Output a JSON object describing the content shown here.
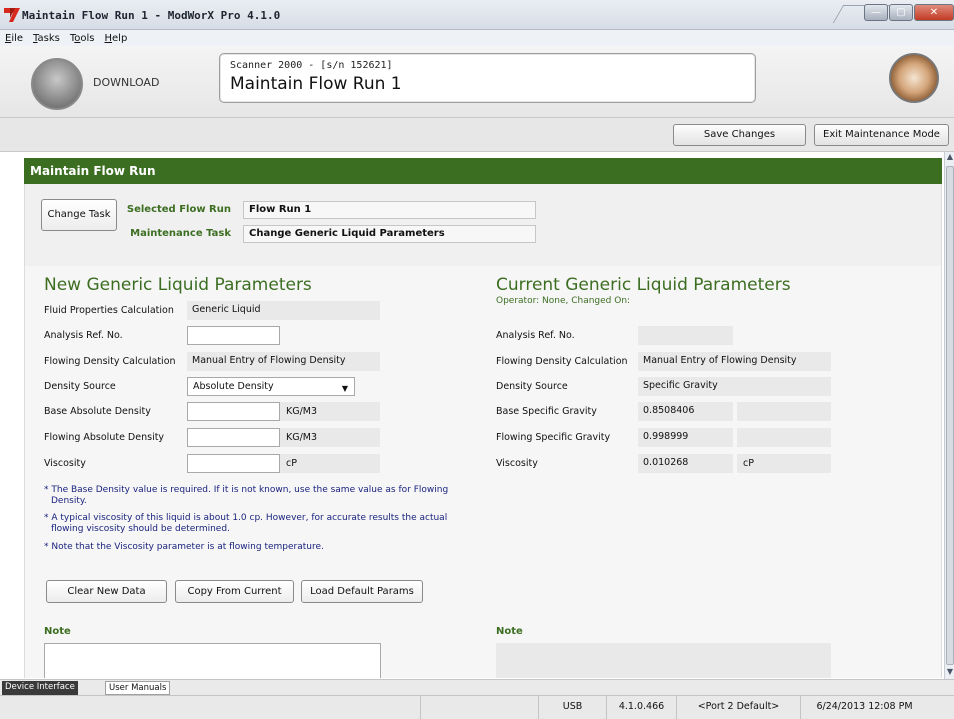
{
  "window": {
    "title": "Maintain Flow Run 1 - ModWorX Pro 4.1.0",
    "minimize": "—",
    "maximize": "▢",
    "close": "✕"
  },
  "menu": [
    {
      "key": "E",
      "rest": "ile"
    },
    {
      "key": "T",
      "rest": "asks"
    },
    {
      "key": "o",
      "pre": "T",
      "rest": "ols"
    },
    {
      "key": "H",
      "rest": "elp"
    }
  ],
  "header": {
    "download_label": "DOWNLOAD",
    "device_line": "Scanner 2000 -  [s/n 152621]",
    "screen_title": "Maintain Flow Run 1"
  },
  "toolbar": {
    "save_changes": "Save Changes",
    "exit_maintenance": "Exit Maintenance Mode"
  },
  "task": {
    "section_title": "Maintain Flow Run",
    "change_task_button": "Change Task",
    "selected_flow_run_label": "Selected Flow Run",
    "selected_flow_run_value": "Flow Run 1",
    "maintenance_task_label": "Maintenance Task",
    "maintenance_task_value": "Change Generic Liquid Parameters"
  },
  "new_params": {
    "title": "New Generic Liquid Parameters",
    "fluid_calc_label": "Fluid Properties Calculation",
    "fluid_calc_value": "Generic Liquid",
    "analysis_ref_label": "Analysis Ref. No.",
    "analysis_ref_value": "",
    "flowing_density_calc_label": "Flowing Density Calculation",
    "flowing_density_calc_value": "Manual Entry of Flowing Density",
    "density_source_label": "Density Source",
    "density_source_value": "Absolute Density",
    "base_abs_density_label": "Base Absolute Density",
    "base_abs_density_value": "",
    "base_abs_density_unit": "KG/M3",
    "flowing_abs_density_label": "Flowing Absolute Density",
    "flowing_abs_density_value": "",
    "flowing_abs_density_unit": "KG/M3",
    "viscosity_label": "Viscosity",
    "viscosity_value": "",
    "viscosity_unit": "cP",
    "note_1a": "* The Base Density value is required. If it is not known, use the same value as for Flowing",
    "note_1b": "Density.",
    "note_2a": "* A typical viscosity of this liquid is about 1.0 cp. However, for accurate results the actual",
    "note_2b": "flowing viscosity should be determined.",
    "note_3": "* Note that the Viscosity parameter is at flowing temperature.",
    "clear_button": "Clear New Data",
    "copy_button": "Copy From Current",
    "load_default_button": "Load Default Params",
    "note_label": "Note"
  },
  "current_params": {
    "title": "Current Generic Liquid Parameters",
    "operator_line": "Operator: None, Changed On:",
    "analysis_ref_label": "Analysis Ref. No.",
    "analysis_ref_value": "",
    "flowing_density_calc_label": "Flowing Density Calculation",
    "flowing_density_calc_value": "Manual Entry of Flowing Density",
    "density_source_label": "Density Source",
    "density_source_value": "Specific Gravity",
    "base_sg_label": "Base Specific Gravity",
    "base_sg_value": "0.8508406",
    "flowing_sg_label": "Flowing Specific Gravity",
    "flowing_sg_value": "0.998999",
    "viscosity_label": "Viscosity",
    "viscosity_value": "0.010268",
    "viscosity_unit": "cP",
    "note_label": "Note"
  },
  "tabs": {
    "device_interface": "Device Interface",
    "user_manuals": "User Manuals"
  },
  "status": {
    "connection": "USB",
    "version": "4.1.0.466",
    "port": "<Port 2 Default>",
    "datetime": "6/24/2013 12:08 PM"
  },
  "colors": {
    "accent_green": "#3c6e22",
    "note_blue": "#1a237e"
  },
  "icons": {
    "app_logo": "modworx-logo-icon",
    "download": "download-circle-icon",
    "fan": "turbine-fan-icon",
    "dropdown": "chevron-down-icon"
  }
}
